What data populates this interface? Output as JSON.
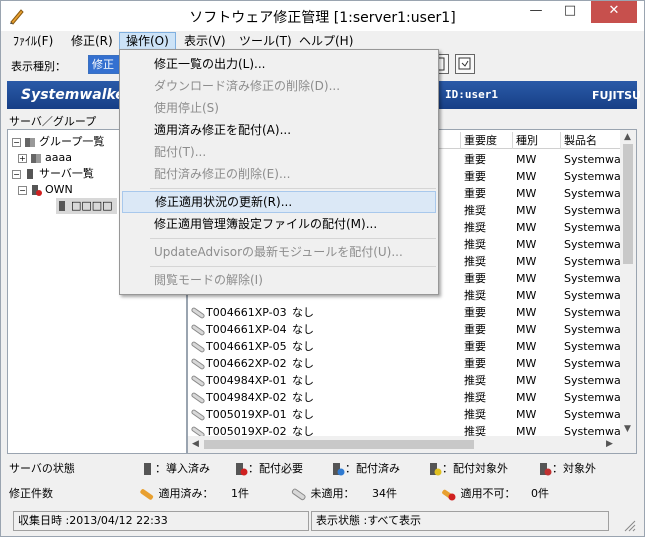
{
  "window": {
    "title": "ソフトウェア修正管理 [1:server1:user1]"
  },
  "menubar": [
    "ﾌｧｲﾙ(F)",
    "修正(R)",
    "操作(O)",
    "表示(V)",
    "ツール(T)",
    "ヘルプ(H)"
  ],
  "toolbar": {
    "label": "表示種別：",
    "combo_value": "修正"
  },
  "banner": {
    "logo": "Systemwalke",
    "id_text": "ID:user1",
    "brand": "FUJITSU"
  },
  "tree": {
    "heading": "サーバ／グループ",
    "items": [
      "グループ一覧",
      "aaaa",
      "サーバ一覧",
      "OWN",
      "□□□□"
    ]
  },
  "list": {
    "headers": [
      "重要度",
      "種別",
      "製品名"
    ],
    "rows_top": [
      {
        "importance": "重要",
        "kind": "MW",
        "product": "Systemwa"
      },
      {
        "importance": "重要",
        "kind": "MW",
        "product": "Systemwa"
      },
      {
        "importance": "重要",
        "kind": "MW",
        "product": "Systemwa"
      },
      {
        "importance": "推奨",
        "kind": "MW",
        "product": "Systemwa"
      },
      {
        "importance": "推奨",
        "kind": "MW",
        "product": "Systemwa"
      },
      {
        "importance": "推奨",
        "kind": "MW",
        "product": "Systemwa"
      },
      {
        "importance": "推奨",
        "kind": "MW",
        "product": "Systemwa"
      },
      {
        "importance": "重要",
        "kind": "MW",
        "product": "Systemwa"
      },
      {
        "importance": "推奨",
        "kind": "MW",
        "product": "Systemwa"
      }
    ],
    "rows": [
      {
        "id": "T004661XP-03",
        "status": "なし",
        "importance": "重要",
        "kind": "MW",
        "product": "Systemwa"
      },
      {
        "id": "T004661XP-04",
        "status": "なし",
        "importance": "重要",
        "kind": "MW",
        "product": "Systemwa"
      },
      {
        "id": "T004661XP-05",
        "status": "なし",
        "importance": "重要",
        "kind": "MW",
        "product": "Systemwa"
      },
      {
        "id": "T004662XP-02",
        "status": "なし",
        "importance": "重要",
        "kind": "MW",
        "product": "Systemwa"
      },
      {
        "id": "T004984XP-01",
        "status": "なし",
        "importance": "推奨",
        "kind": "MW",
        "product": "Systemwa"
      },
      {
        "id": "T004984XP-02",
        "status": "なし",
        "importance": "推奨",
        "kind": "MW",
        "product": "Systemwa"
      },
      {
        "id": "T005019XP-01",
        "status": "なし",
        "importance": "推奨",
        "kind": "MW",
        "product": "Systemwa"
      },
      {
        "id": "T005019XP-02",
        "status": "なし",
        "importance": "推奨",
        "kind": "MW",
        "product": "Systemwa"
      }
    ]
  },
  "dropdown": [
    {
      "label": "修正一覧の出力(L)...",
      "disabled": false
    },
    {
      "label": "ダウンロード済み修正の削除(D)...",
      "disabled": true
    },
    {
      "label": "使用停止(S)",
      "disabled": true
    },
    {
      "label": "適用済み修正を配付(A)...",
      "disabled": false
    },
    {
      "label": "配付(T)...",
      "disabled": true
    },
    {
      "label": "配付済み修正の削除(E)...",
      "disabled": true
    },
    {
      "label": "修正適用状況の更新(R)...",
      "disabled": false
    },
    {
      "label": "修正適用管理簿設定ファイルの配付(M)...",
      "disabled": false
    },
    {
      "label": "UpdateAdvisorの最新モジュールを配付(U)...",
      "disabled": true
    },
    {
      "label": "閲覧モードの解除(I)",
      "disabled": true
    }
  ],
  "legend": {
    "server_state_label": "サーバの状態",
    "installed": "：導入済み",
    "needs_distribution": "：配付必要",
    "distributed": "：配付済み",
    "excluded_target": "：配付対象外",
    "not_applicable": "：対象外",
    "patch_count_label": "修正件数",
    "applied_label": "適用済み：",
    "applied_count": "1件",
    "unapplied_label": "未適用：",
    "unapplied_count": "34件",
    "cannot_apply_label": "適用不可：",
    "cannot_apply_count": "0件"
  },
  "statusbar": {
    "collected": "収集日時 :2013/04/12 22:33",
    "display_state": "表示状態 :すべて表示"
  },
  "colors": {
    "banner": "#1f4b95",
    "menu_highlight": "#cde3f7",
    "close_button": "#c7504d"
  }
}
